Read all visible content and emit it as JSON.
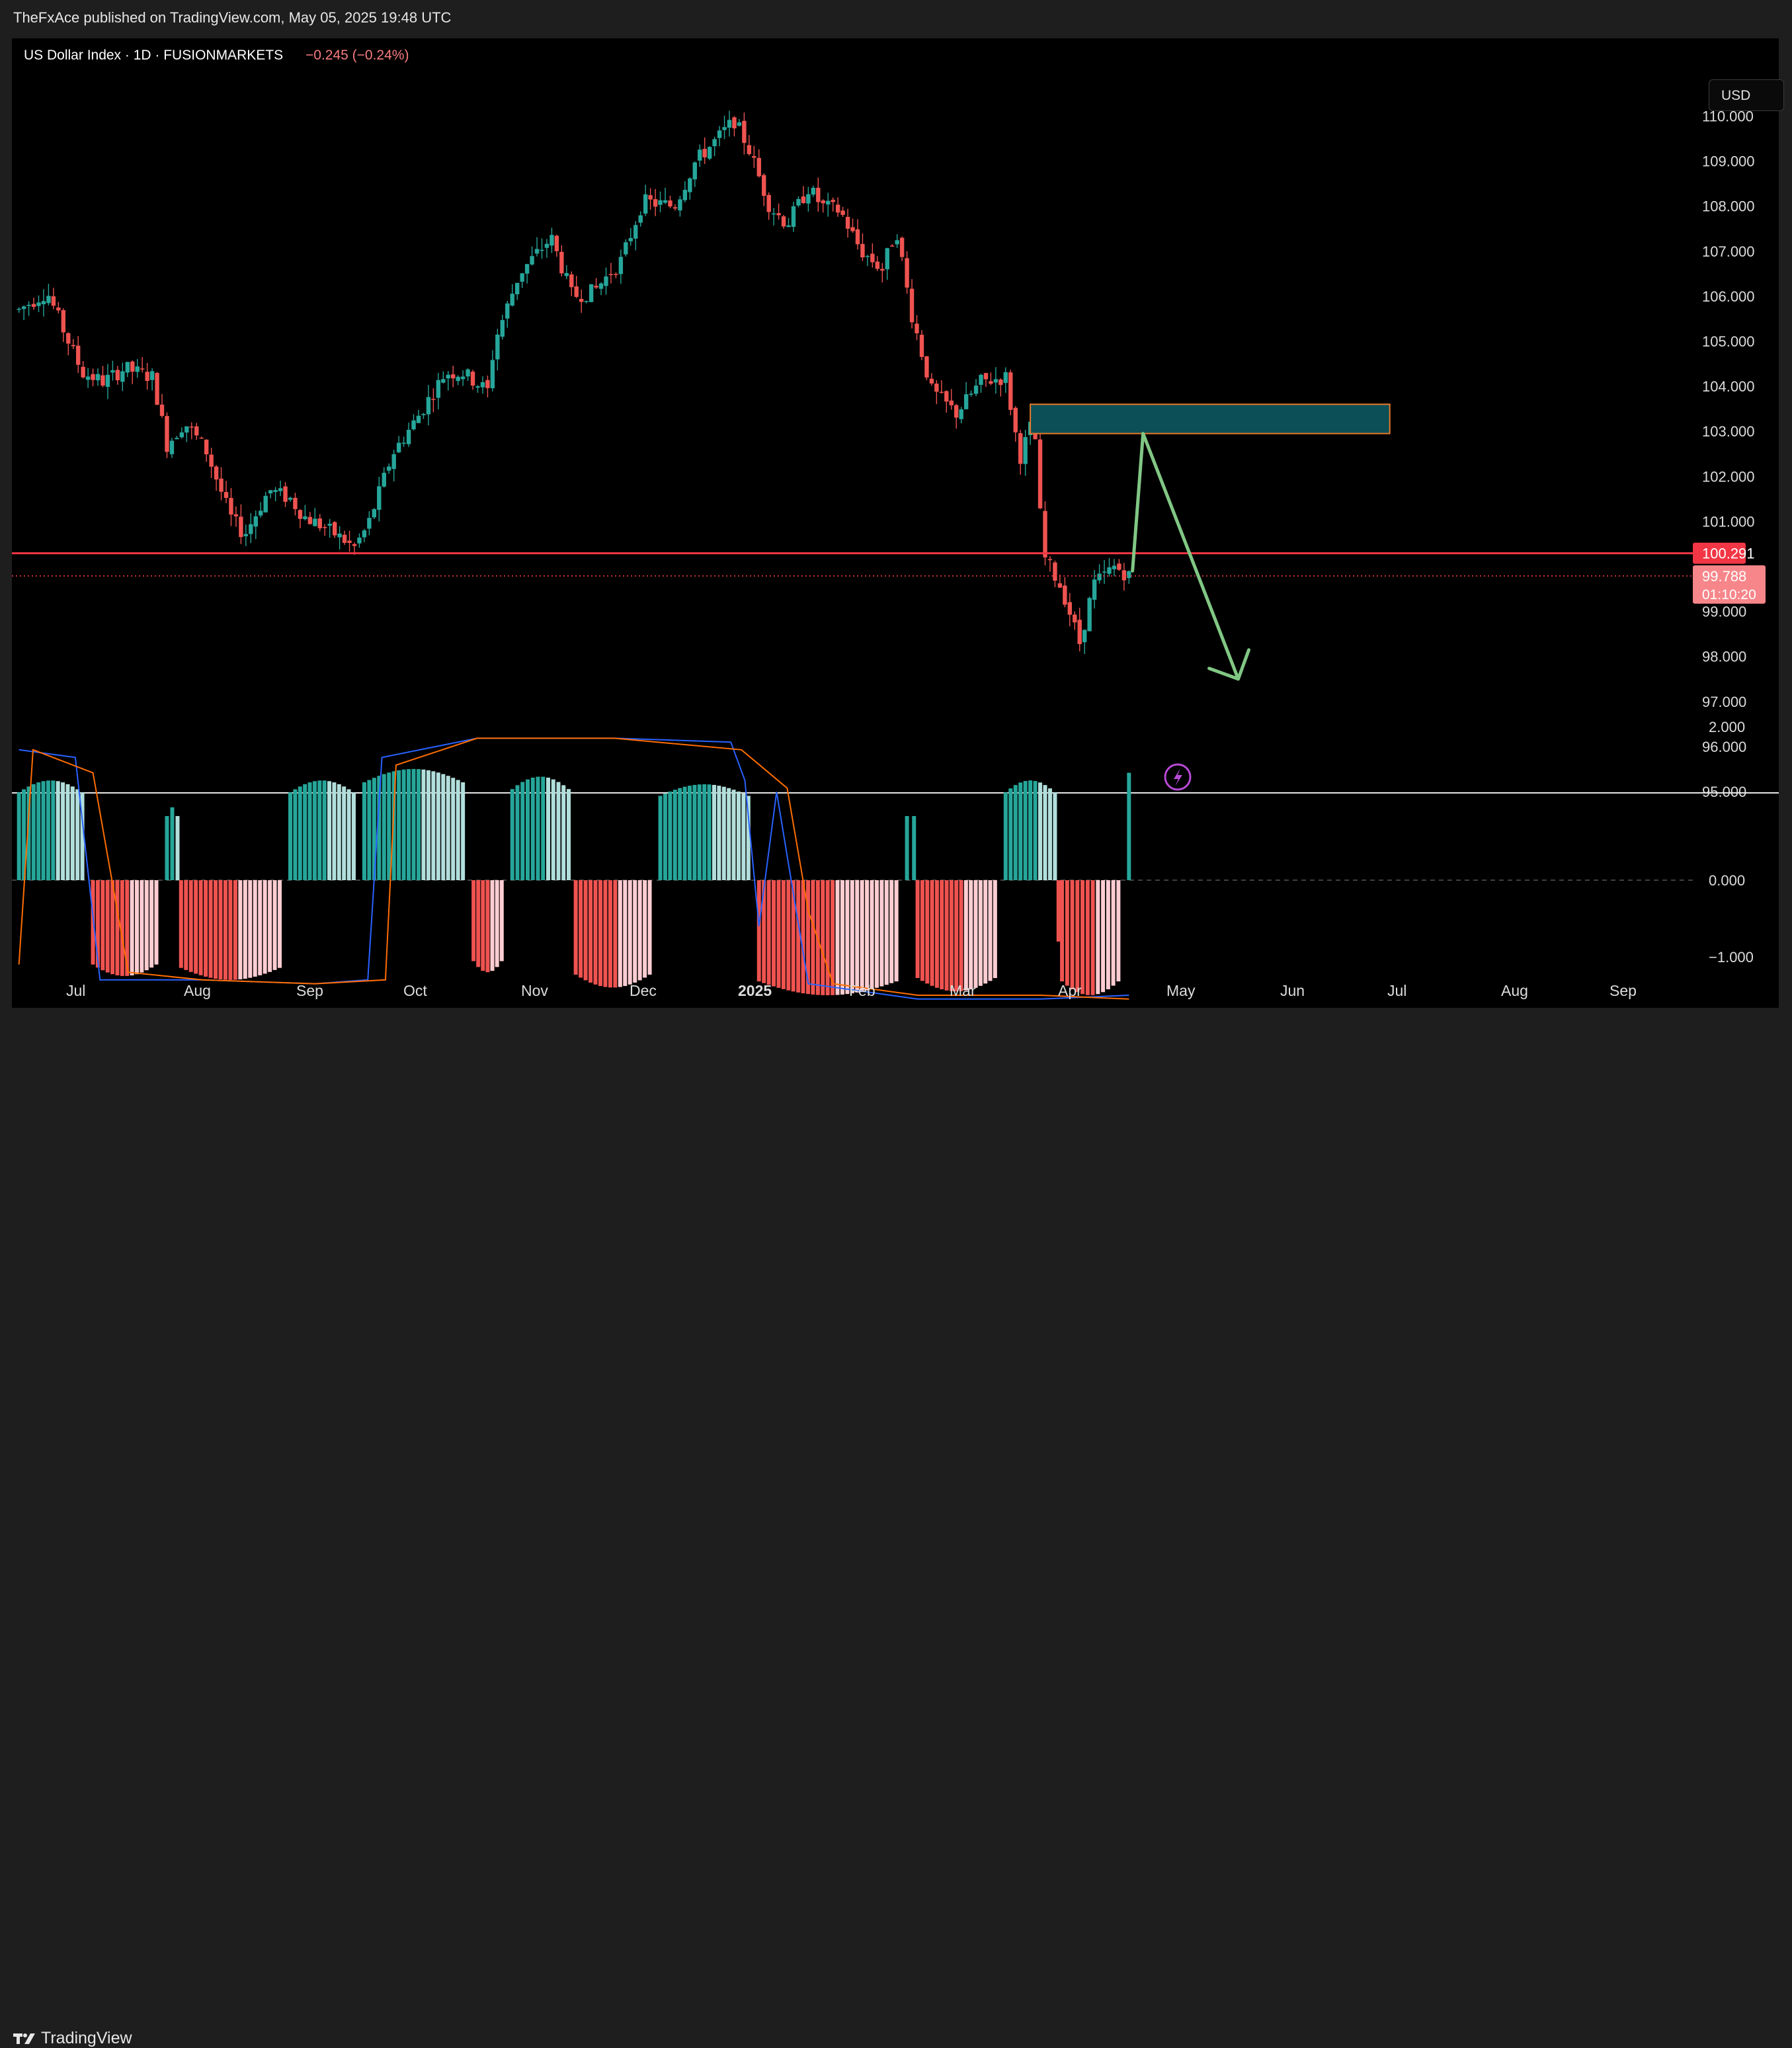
{
  "publisher": "TheFxAce published on TradingView.com, May 05, 2025 19:48 UTC",
  "footer_brand": "TradingView",
  "currency_button": "USD",
  "symbol": {
    "name": "US Dollar Index · 1D · FUSIONMARKETS",
    "change": "−0.245 (−0.24%)"
  },
  "colors": {
    "up": "#26a69a",
    "down": "#ef5350",
    "level": "#f23645",
    "zone_fill": "#0d4f56",
    "zone_border": "#e87a2c",
    "arrow": "#81c784",
    "macd_blue": "#2962ff",
    "signal_orange": "#ff6d00"
  },
  "icons": {
    "alert": "lightning-bolt-icon",
    "logo": "tradingview-logo-icon"
  },
  "chart_data": [
    {
      "type": "candlestick",
      "title": "US Dollar Index · 1D · FUSIONMARKETS",
      "xlabel": "",
      "ylabel": "",
      "ylim": [
        94.75,
        111.0
      ],
      "grid": false,
      "price_ticks": [
        "110.000",
        "109.000",
        "108.000",
        "107.000",
        "106.000",
        "105.000",
        "104.000",
        "103.000",
        "102.000",
        "101.000",
        "99.000",
        "98.000",
        "97.000",
        "96.000",
        "95.000"
      ],
      "time_labels": [
        "Jul",
        "Aug",
        "Sep",
        "Oct",
        "Nov",
        "Dec",
        "2025",
        "Feb",
        "Mar",
        "Apr",
        "May",
        "Jun",
        "Jul",
        "Aug",
        "Sep"
      ],
      "price_path": [
        {
          "x": "2024-06-24",
          "y": 105.7
        },
        {
          "x": "2024-06-28",
          "y": 105.9
        },
        {
          "x": "2024-07-02",
          "y": 106.1
        },
        {
          "x": "2024-07-08",
          "y": 105.0
        },
        {
          "x": "2024-07-12",
          "y": 104.3
        },
        {
          "x": "2024-07-18",
          "y": 104.1
        },
        {
          "x": "2024-07-24",
          "y": 104.4
        },
        {
          "x": "2024-08-01",
          "y": 104.2
        },
        {
          "x": "2024-08-05",
          "y": 102.7
        },
        {
          "x": "2024-08-10",
          "y": 103.2
        },
        {
          "x": "2024-08-16",
          "y": 102.6
        },
        {
          "x": "2024-08-23",
          "y": 101.1
        },
        {
          "x": "2024-08-27",
          "y": 100.7
        },
        {
          "x": "2024-09-03",
          "y": 101.7
        },
        {
          "x": "2024-09-09",
          "y": 101.5
        },
        {
          "x": "2024-09-13",
          "y": 101.1
        },
        {
          "x": "2024-09-18",
          "y": 100.9
        },
        {
          "x": "2024-09-24",
          "y": 100.6
        },
        {
          "x": "2024-09-27",
          "y": 100.4
        },
        {
          "x": "2024-10-01",
          "y": 100.9
        },
        {
          "x": "2024-10-08",
          "y": 102.5
        },
        {
          "x": "2024-10-15",
          "y": 103.3
        },
        {
          "x": "2024-10-23",
          "y": 104.3
        },
        {
          "x": "2024-10-28",
          "y": 104.3
        },
        {
          "x": "2024-11-04",
          "y": 103.9
        },
        {
          "x": "2024-11-06",
          "y": 105.0
        },
        {
          "x": "2024-11-13",
          "y": 106.5
        },
        {
          "x": "2024-11-22",
          "y": 107.3
        },
        {
          "x": "2024-11-28",
          "y": 106.0
        },
        {
          "x": "2024-12-04",
          "y": 106.1
        },
        {
          "x": "2024-12-12",
          "y": 106.8
        },
        {
          "x": "2024-12-18",
          "y": 108.1
        },
        {
          "x": "2024-12-27",
          "y": 108.0
        },
        {
          "x": "2025-01-02",
          "y": 109.0
        },
        {
          "x": "2025-01-07",
          "y": 109.4
        },
        {
          "x": "2025-01-13",
          "y": 109.9
        },
        {
          "x": "2025-01-17",
          "y": 109.3
        },
        {
          "x": "2025-01-23",
          "y": 108.0
        },
        {
          "x": "2025-01-28",
          "y": 107.6
        },
        {
          "x": "2025-02-03",
          "y": 108.4
        },
        {
          "x": "2025-02-07",
          "y": 108.0
        },
        {
          "x": "2025-02-12",
          "y": 107.9
        },
        {
          "x": "2025-02-18",
          "y": 107.0
        },
        {
          "x": "2025-02-24",
          "y": 106.6
        },
        {
          "x": "2025-02-28",
          "y": 107.5
        },
        {
          "x": "2025-03-04",
          "y": 105.7
        },
        {
          "x": "2025-03-10",
          "y": 103.9
        },
        {
          "x": "2025-03-17",
          "y": 103.4
        },
        {
          "x": "2025-03-24",
          "y": 104.1
        },
        {
          "x": "2025-03-31",
          "y": 104.2
        },
        {
          "x": "2025-04-04",
          "y": 102.4
        },
        {
          "x": "2025-04-08",
          "y": 103.3
        },
        {
          "x": "2025-04-10",
          "y": 100.9
        },
        {
          "x": "2025-04-11",
          "y": 100.2
        },
        {
          "x": "2025-04-16",
          "y": 99.5
        },
        {
          "x": "2025-04-21",
          "y": 98.3
        },
        {
          "x": "2025-04-25",
          "y": 99.6
        },
        {
          "x": "2025-05-01",
          "y": 100.0
        },
        {
          "x": "2025-05-05",
          "y": 99.788
        }
      ],
      "horizontal_level": {
        "price": 100.291,
        "label": "100.291"
      },
      "last_price": {
        "price": 99.788,
        "label": "99.788",
        "countdown": "01:10:20"
      },
      "zone": {
        "x_start": "2025-04-07",
        "x_end": "2025-07-18",
        "y_low": 102.95,
        "y_high": 103.6
      },
      "projection_path": [
        {
          "x": "2025-05-06",
          "y": 99.9
        },
        {
          "x": "2025-05-09",
          "y": 102.95
        },
        {
          "x": "2025-06-05",
          "y": 97.5
        }
      ]
    },
    {
      "type": "bar",
      "title": "",
      "ylim": [
        -1.5,
        2.15
      ],
      "zero_line": "dashed",
      "y_ticks": [
        "2.000",
        "0.000",
        "−1.000"
      ],
      "histogram_segments": [
        {
          "from": "2024-06-24",
          "to": "2024-07-12",
          "value": 1.3
        },
        {
          "from": "2024-07-15",
          "to": "2024-08-02",
          "value": -1.25
        },
        {
          "from": "2024-08-05",
          "to": "2024-08-08",
          "value": 0.95
        },
        {
          "from": "2024-08-09",
          "to": "2024-09-06",
          "value": -1.3
        },
        {
          "from": "2024-09-09",
          "to": "2024-09-27",
          "value": 1.3
        },
        {
          "from": "2024-09-30",
          "to": "2024-10-28",
          "value": 1.45
        },
        {
          "from": "2024-10-31",
          "to": "2024-11-08",
          "value": -1.2
        },
        {
          "from": "2024-11-11",
          "to": "2024-11-27",
          "value": 1.35
        },
        {
          "from": "2024-11-29",
          "to": "2024-12-20",
          "value": -1.4
        },
        {
          "from": "2024-12-23",
          "to": "2025-01-17",
          "value": 1.25
        },
        {
          "from": "2025-01-20",
          "to": "2025-02-28",
          "value": -1.5
        },
        {
          "from": "2025-03-03",
          "to": "2025-03-05",
          "value": 0.95
        },
        {
          "from": "2025-03-06",
          "to": "2025-03-28",
          "value": -1.45
        },
        {
          "from": "2025-03-31",
          "to": "2025-04-14",
          "value": 1.3
        },
        {
          "from": "2025-04-15",
          "to": "2025-04-15",
          "value": -0.8
        },
        {
          "from": "2025-04-16",
          "to": "2025-05-02",
          "value": -1.5
        },
        {
          "from": "2025-05-05",
          "to": "2025-05-05",
          "value": 1.4
        }
      ],
      "series": [
        {
          "color": "blue",
          "values": [
            {
              "x": "2024-06-24",
              "y": 1.7
            },
            {
              "x": "2024-07-10",
              "y": 1.6
            },
            {
              "x": "2024-07-17",
              "y": -1.3
            },
            {
              "x": "2024-08-15",
              "y": -1.3
            },
            {
              "x": "2024-09-16",
              "y": -1.35
            },
            {
              "x": "2024-10-01",
              "y": -1.3
            },
            {
              "x": "2024-10-05",
              "y": 1.6
            },
            {
              "x": "2024-11-01",
              "y": 1.85
            },
            {
              "x": "2024-12-10",
              "y": 1.85
            },
            {
              "x": "2025-01-12",
              "y": 1.8
            },
            {
              "x": "2025-01-16",
              "y": 1.3
            },
            {
              "x": "2025-01-20",
              "y": -0.6
            },
            {
              "x": "2025-01-25",
              "y": 1.15
            },
            {
              "x": "2025-02-03",
              "y": -1.35
            },
            {
              "x": "2025-03-06",
              "y": -1.55
            },
            {
              "x": "2025-04-10",
              "y": -1.55
            },
            {
              "x": "2025-05-05",
              "y": -1.5
            }
          ]
        },
        {
          "color": "orange",
          "values": [
            {
              "x": "2024-06-24",
              "y": -1.1
            },
            {
              "x": "2024-06-28",
              "y": 1.7
            },
            {
              "x": "2024-07-15",
              "y": 1.4
            },
            {
              "x": "2024-07-25",
              "y": -1.2
            },
            {
              "x": "2024-08-15",
              "y": -1.3
            },
            {
              "x": "2024-09-16",
              "y": -1.35
            },
            {
              "x": "2024-10-06",
              "y": -1.3
            },
            {
              "x": "2024-10-09",
              "y": 1.5
            },
            {
              "x": "2024-11-01",
              "y": 1.85
            },
            {
              "x": "2024-12-10",
              "y": 1.85
            },
            {
              "x": "2025-01-15",
              "y": 1.7
            },
            {
              "x": "2025-01-28",
              "y": 1.2
            },
            {
              "x": "2025-02-03",
              "y": -0.4
            },
            {
              "x": "2025-02-10",
              "y": -1.35
            },
            {
              "x": "2025-03-06",
              "y": -1.5
            },
            {
              "x": "2025-04-10",
              "y": -1.5
            },
            {
              "x": "2025-05-05",
              "y": -1.55
            }
          ]
        }
      ]
    }
  ]
}
